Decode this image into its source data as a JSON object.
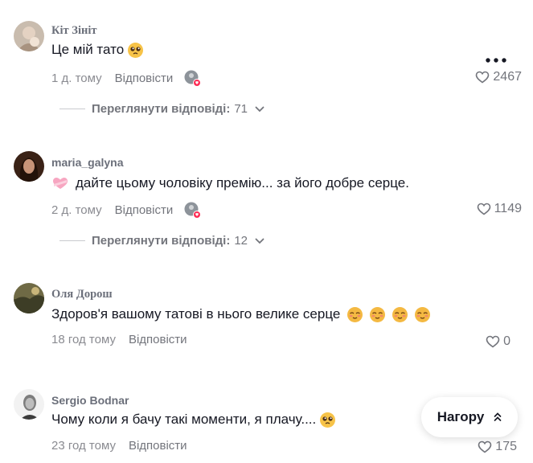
{
  "comments": [
    {
      "username": "Кіт Зініт",
      "text": "Це мій тато",
      "text_emoji": "pleading-face",
      "time": "1 д. тому",
      "reply_label": "Відповісти",
      "likes": "2467",
      "replies_label": "Переглянути відповіді:",
      "replies_count": "71"
    },
    {
      "username": "maria_galyna",
      "text": "дайте цьому чоловіку премію... за його добре серце.",
      "text_emoji": "heart-ribbon",
      "time": "2 д. тому",
      "reply_label": "Відповісти",
      "likes": "1149",
      "replies_label": "Переглянути відповіді:",
      "replies_count": "12"
    },
    {
      "username": "Оля Дорош",
      "text": "Здоров'я вашому татові в нього велике серце",
      "text_emoji": "relieved-face x4",
      "time": "18 год тому",
      "reply_label": "Відповісти",
      "likes": "0"
    },
    {
      "username": "Sergio Bodnar",
      "text": "Чому коли я бачу такі моменти, я плачу....",
      "text_emoji": "pleading-face",
      "time": "23 год тому",
      "reply_label": "Відповісти",
      "likes": "175"
    }
  ],
  "scroll_top_label": "Нагору",
  "colors": {
    "text": "#161823",
    "muted": "#8a8b91",
    "like_badge": "#fe2c55"
  }
}
